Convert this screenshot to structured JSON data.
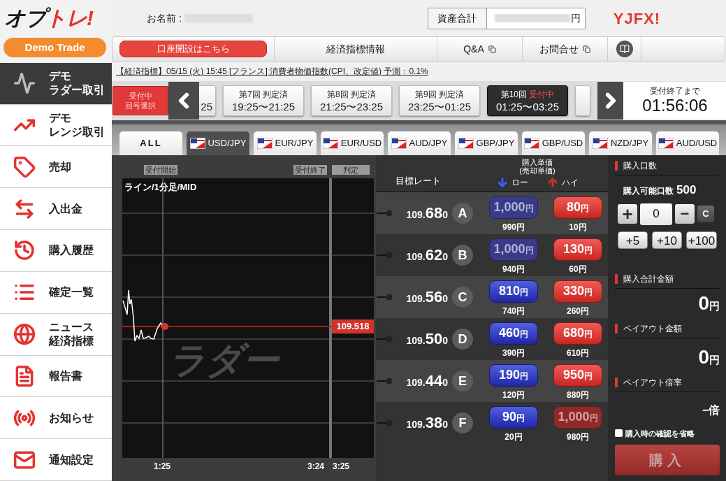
{
  "header": {
    "logo": {
      "part_1": "オプ",
      "part_2": "トレ!"
    },
    "mode_badge": "Demo Trade",
    "name_label": "お名前 :",
    "assets_label": "資産合計",
    "assets_unit": "円",
    "brand": "YJFX!"
  },
  "sidebar": [
    {
      "lines": [
        "デモ",
        "ラダー取引"
      ],
      "selected": true
    },
    {
      "lines": [
        "デモ",
        "レンジ取引"
      ],
      "selected": false
    },
    {
      "lines": [
        "売却"
      ],
      "selected": false
    },
    {
      "lines": [
        "入出金"
      ],
      "selected": false
    },
    {
      "lines": [
        "購入履歴"
      ],
      "selected": false
    },
    {
      "lines": [
        "確定一覧"
      ],
      "selected": false
    },
    {
      "lines": [
        "ニュース",
        "経済指標"
      ],
      "selected": false
    },
    {
      "lines": [
        "報告書"
      ],
      "selected": false
    },
    {
      "lines": [
        "お知らせ"
      ],
      "selected": false
    },
    {
      "lines": [
        "通知設定"
      ],
      "selected": false
    }
  ],
  "nav": [
    {
      "kind": "primary",
      "label": "口座開設はこちら"
    },
    {
      "kind": "plain",
      "label": "経済指標情報"
    },
    {
      "kind": "external",
      "label": "Q&A"
    },
    {
      "kind": "external",
      "label": "お問合せ"
    },
    {
      "kind": "book"
    }
  ],
  "ticker": "【経済指標】05/15 (火) 15:45 [フランス] 消費者物価指数(CPI、改定値) 予測：0.1%",
  "rounds": {
    "status_button": [
      "受付中",
      "回号選択"
    ],
    "cards": [
      {
        "kind": "cut_left",
        "time": "25",
        "selected": false
      },
      {
        "kind": "full",
        "title": "第7回",
        "status": "判定済",
        "time": "19:25〜21:25",
        "selected": false
      },
      {
        "kind": "full",
        "title": "第8回",
        "status": "判定済",
        "time": "21:25〜23:25",
        "selected": false
      },
      {
        "kind": "full",
        "title": "第9回",
        "status": "判定済",
        "time": "23:25〜01:25",
        "selected": false
      },
      {
        "kind": "full",
        "title": "第10回",
        "status": "受付中",
        "time": "01:25〜03:25",
        "selected": true
      },
      {
        "kind": "cut_right",
        "selected": false
      }
    ],
    "countdown": {
      "label": "受付終了まで",
      "value": "01:56:06"
    }
  },
  "pairs": [
    {
      "kind": "all",
      "label": "ALL",
      "selected": false
    },
    {
      "kind": "pair",
      "label": "USD/JPY",
      "selected": true
    },
    {
      "kind": "pair",
      "label": "EUR/JPY",
      "selected": false
    },
    {
      "kind": "pair",
      "label": "EUR/USD",
      "selected": false
    },
    {
      "kind": "pair",
      "label": "AUD/JPY",
      "selected": false
    },
    {
      "kind": "pair",
      "label": "GBP/JPY",
      "selected": false
    },
    {
      "kind": "pair",
      "label": "GBP/USD",
      "selected": false
    },
    {
      "kind": "pair",
      "label": "NZD/JPY",
      "selected": false
    },
    {
      "kind": "pair",
      "label": "AUD/USD",
      "selected": false
    }
  ],
  "chart": {
    "start_label": "受付開始",
    "end_label": "受付終了",
    "judge_label": "判定",
    "title": "ライン/1分足/MID",
    "current_price": "109.518",
    "watermark": "ラダー",
    "x_labels": [
      "1:25",
      "3:24",
      "3:25"
    ]
  },
  "ladder": {
    "rate_header": "目標レート",
    "price_header": [
      "購入単価",
      "(売却単価)"
    ],
    "low_label": "ロー",
    "high_label": "ハイ",
    "rows": [
      {
        "letter": "A",
        "rate": [
          "109.",
          "68",
          "0"
        ],
        "low": {
          "amount": "1,000",
          "unit": "円",
          "disabled": true,
          "sell": "990円"
        },
        "high": {
          "amount": "80",
          "unit": "円",
          "disabled": false,
          "sell": "10円"
        }
      },
      {
        "letter": "B",
        "rate": [
          "109.",
          "62",
          "0"
        ],
        "low": {
          "amount": "1,000",
          "unit": "円",
          "disabled": true,
          "sell": "940円"
        },
        "high": {
          "amount": "130",
          "unit": "円",
          "disabled": false,
          "sell": "60円"
        }
      },
      {
        "letter": "C",
        "rate": [
          "109.",
          "56",
          "0"
        ],
        "low": {
          "amount": "810",
          "unit": "円",
          "disabled": false,
          "sell": "740円"
        },
        "high": {
          "amount": "330",
          "unit": "円",
          "disabled": false,
          "sell": "260円"
        }
      },
      {
        "letter": "D",
        "rate": [
          "109.",
          "50",
          "0"
        ],
        "low": {
          "amount": "460",
          "unit": "円",
          "disabled": false,
          "sell": "390円"
        },
        "high": {
          "amount": "680",
          "unit": "円",
          "disabled": false,
          "sell": "610円"
        }
      },
      {
        "letter": "E",
        "rate": [
          "109.",
          "44",
          "0"
        ],
        "low": {
          "amount": "190",
          "unit": "円",
          "disabled": false,
          "sell": "120円"
        },
        "high": {
          "amount": "950",
          "unit": "円",
          "disabled": false,
          "sell": "880円"
        }
      },
      {
        "letter": "F",
        "rate": [
          "109.",
          "38",
          "0"
        ],
        "low": {
          "amount": "90",
          "unit": "円",
          "disabled": false,
          "sell": "20円"
        },
        "high": {
          "amount": "1,000",
          "unit": "円",
          "disabled": true,
          "sell": "980円"
        }
      }
    ]
  },
  "order": {
    "units_title": "購入口数",
    "available_label": "購入可能口数",
    "available_value": "500",
    "plus": "+",
    "quantity": "0",
    "minus": "−",
    "clear": "C",
    "steps": [
      "+5",
      "+10",
      "+100"
    ],
    "total_title": "購入合計金額",
    "total_value": "0",
    "total_unit": "円",
    "payout_title": "ペイアウト金額",
    "payout_value": "0",
    "payout_unit": "円",
    "ratio_title": "ペイアウト倍率",
    "ratio_value": "−",
    "ratio_unit": "倍",
    "skip_confirm": {
      "label": "購入時の確認を省略",
      "checked": false
    },
    "buy_button": "購入"
  }
}
